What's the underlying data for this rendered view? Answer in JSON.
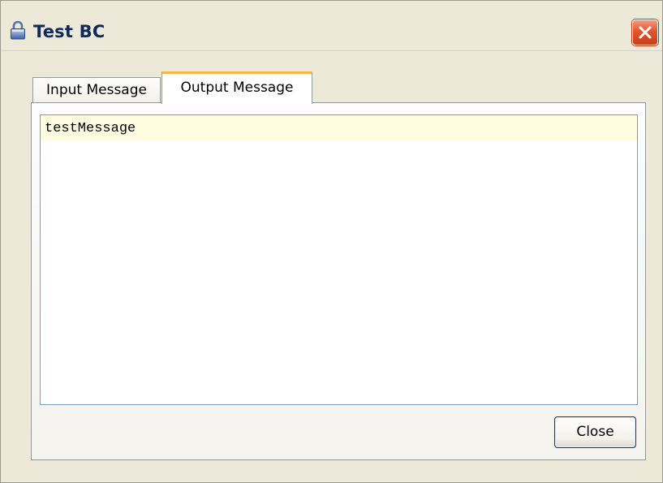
{
  "window": {
    "title": "Test BC",
    "icon": "lock-icon",
    "close_icon": "close-icon"
  },
  "tabs": [
    {
      "label": "Input Message",
      "selected": false
    },
    {
      "label": "Output Message",
      "selected": true
    }
  ],
  "output": {
    "text": "testMessage"
  },
  "buttons": {
    "close_label": "Close"
  },
  "colors": {
    "selected_tab_accent": "#f4b845",
    "current_line_highlight": "#fdfce1",
    "window_background": "#ece9d8",
    "titlebar_close_red": "#e2552c"
  }
}
